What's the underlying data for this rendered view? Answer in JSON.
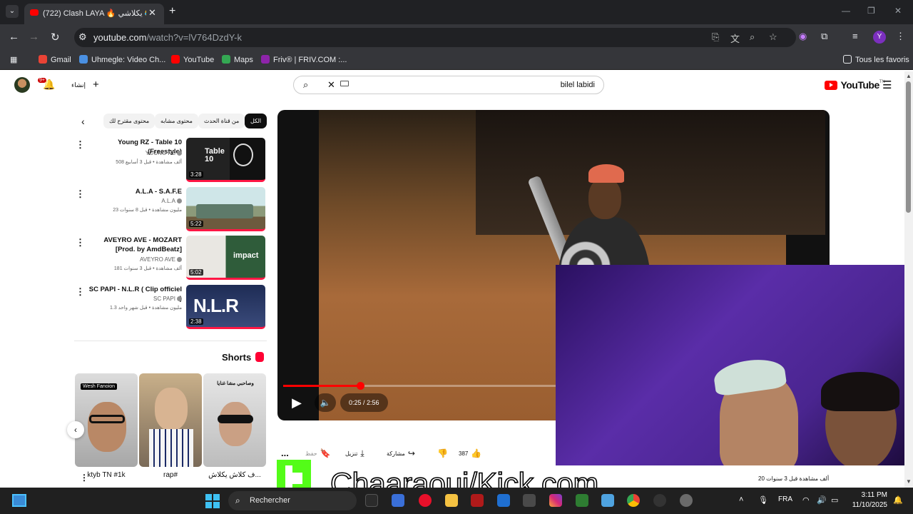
{
  "browser": {
    "tab_title": "(722) Clash LAYA 🔥 يكلاشي 😂 ...",
    "tab_close": "✕",
    "new_tab": "+",
    "url_host": "youtube.com",
    "url_path": "/watch?v=lV764DzdY-k",
    "profile_letter": "Y",
    "bookmarks": [
      {
        "label": "Gmail",
        "color": "#ea4335"
      },
      {
        "label": "Uhmegle: Video Ch...",
        "color": "#4a90e2"
      },
      {
        "label": "YouTube",
        "color": "#ff0000"
      },
      {
        "label": "Maps",
        "color": "#34a853"
      },
      {
        "label": "Friv® | FRIV.COM :...",
        "color": "#8e24aa"
      }
    ],
    "all_favorites": "Tous les favoris"
  },
  "yt": {
    "notif_count": "9+",
    "create_label": "إنشاء",
    "search_value": "bilel labidi",
    "logo_word": "YouTube",
    "logo_region": "TN",
    "chips": [
      "الكل",
      "من قناة الحدث",
      "محتوى مشابه",
      "محتوى مقترح لك"
    ],
    "recommended": [
      {
        "title": "Young RZ - Table 10 (Freestyle)",
        "channel": "YOUNG RZ",
        "meta": "508 ألف مشاهدة • قبل 3 أسابيع",
        "duration": "3:28",
        "thumb_text": "Table 10"
      },
      {
        "title": "A.L.A - S.A.F.E",
        "channel": "A.L.A",
        "meta": "23 مليون مشاهدة • قبل 8 سنوات",
        "duration": "5:22",
        "thumb_text": ""
      },
      {
        "title": "AVEYRO AVE - MOZART [Prod. by AmdBeatz]",
        "channel": "AVEYRO AVE",
        "meta": "181 ألف مشاهدة • قبل 3 سنوات",
        "duration": "5:02",
        "thumb_text": "impact"
      },
      {
        "title": "SC PAPI - N.L.R ( Clip officiel )",
        "channel": "SC PAPI",
        "meta": "1.3 مليون مشاهدة • قبل شهر واحد",
        "duration": "2:38",
        "thumb_text": "N.L.R"
      }
    ],
    "shorts_label": "Shorts",
    "shorts": [
      {
        "caption": "ktyb TN #1k",
        "overlay": "Wesh Fanoion"
      },
      {
        "caption": "rap#",
        "overlay": ""
      },
      {
        "caption": "ف كلاش يكلاش...",
        "overlay": "وصاحبي مشا غنايا"
      }
    ],
    "player": {
      "time": "0:25 / 2:56",
      "progress": 0.142
    },
    "actions": {
      "likes": "387",
      "share": "مشاركة",
      "download": "تنزيل",
      "save": "حفظ",
      "more": "..."
    },
    "views_text": "20 ألف مشاهدة قبل 3 سنوات"
  },
  "overlay": {
    "kick_url": "Chaaraoui/Kick.com"
  },
  "taskbar": {
    "search_label": "Rechercher",
    "lang": "FRA",
    "time": "3:11 PM",
    "date": "11/10/2025"
  }
}
